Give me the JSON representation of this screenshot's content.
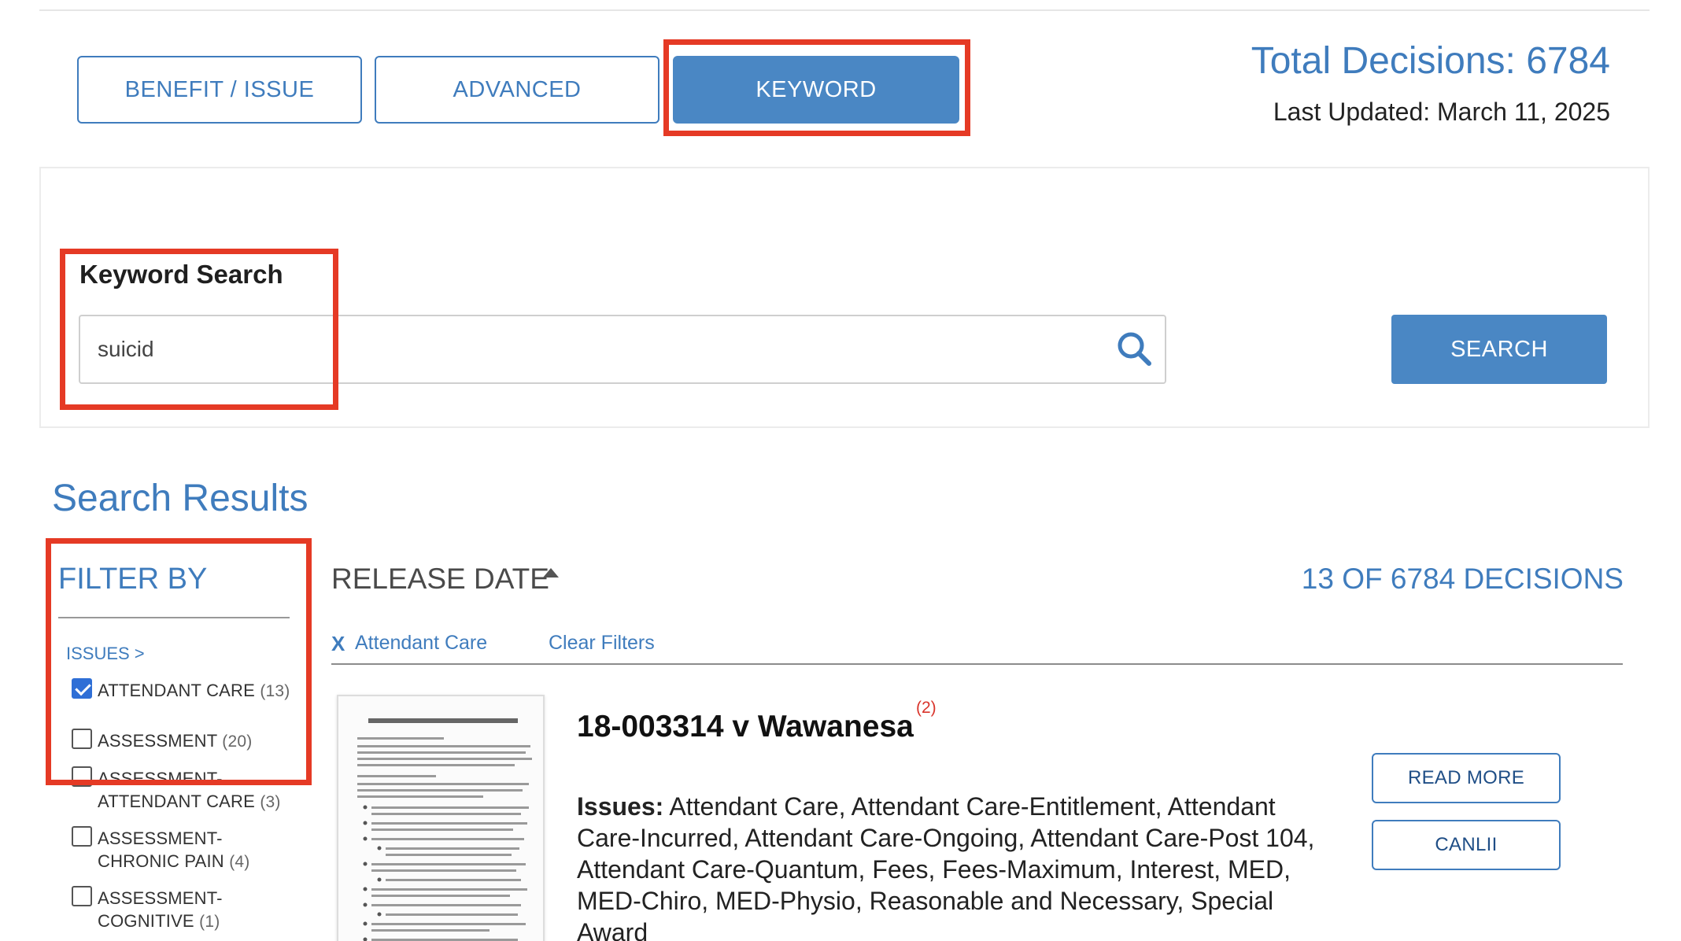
{
  "tabs": [
    {
      "label": "BENEFIT / ISSUE",
      "active": false
    },
    {
      "label": "ADVANCED",
      "active": false
    },
    {
      "label": "KEYWORD",
      "active": true
    }
  ],
  "stats": {
    "total_decisions": "Total Decisions: 6784",
    "last_updated": "Last Updated: March 11, 2025"
  },
  "search": {
    "label": "Keyword Search",
    "value": "suicid",
    "button_label": "SEARCH",
    "icon": "search-icon"
  },
  "results": {
    "title": "Search Results",
    "sort_label": "RELEASE DATE",
    "count_label": "13 OF 6784 DECISIONS",
    "active_filter_x": "X",
    "active_filter": "Attendant Care",
    "clear_filters": "Clear Filters"
  },
  "filters": {
    "title": "FILTER BY",
    "issues_link": "ISSUES >",
    "items": [
      {
        "lines": [
          "ATTENDANT CARE"
        ],
        "count": "(13)",
        "checked": true
      },
      {
        "lines": [
          "ASSESSMENT"
        ],
        "count": "(20)",
        "checked": false
      },
      {
        "lines": [
          "ASSESSMENT-",
          "ATTENDANT CARE"
        ],
        "count": "(3)",
        "checked": false
      },
      {
        "lines": [
          "ASSESSMENT-",
          "CHRONIC PAIN"
        ],
        "count": "(4)",
        "checked": false
      },
      {
        "lines": [
          "ASSESSMENT-",
          "COGNITIVE"
        ],
        "count": "(1)",
        "checked": false
      }
    ]
  },
  "result_card": {
    "title": "18-003314 v Wawanesa",
    "badge": "(2)",
    "issues_label": "Issues:",
    "issues_text": "Attendant Care, Attendant Care-Entitlement, Attendant Care-Incurred, Attendant Care-Ongoing, Attendant Care-Post 104, Attendant Care-Quantum, Fees, Fees-Maximum, Interest, MED, MED-Chiro, MED-Physio, Reasonable and Necessary, Special Award",
    "read_more": "READ MORE",
    "canlii": "CANLII"
  },
  "colors": {
    "accent": "#4a87c4",
    "link": "#3f7cbd",
    "highlight": "#e53a25",
    "checkbox_checked": "#2f6fd6"
  }
}
